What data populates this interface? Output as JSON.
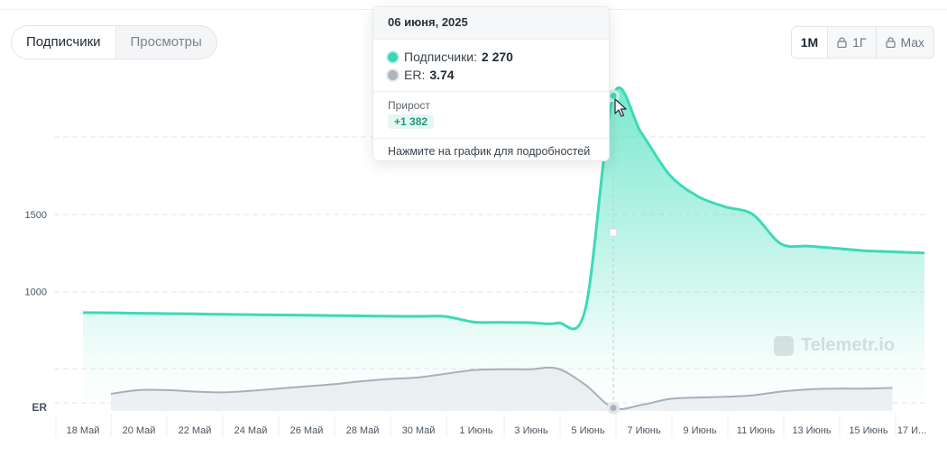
{
  "tabs": [
    {
      "label": "Подписчики",
      "active": true
    },
    {
      "label": "Просмотры",
      "active": false
    }
  ],
  "period": [
    {
      "label": "1М",
      "active": true,
      "locked": false,
      "icon": ""
    },
    {
      "label": "1Г",
      "active": false,
      "locked": true,
      "icon": "lock-icon"
    },
    {
      "label": "Max",
      "active": false,
      "locked": true,
      "icon": "lock-icon"
    }
  ],
  "tooltip": {
    "date": "06 июня, 2025",
    "subs_label": "Подписчики:",
    "subs_value": "2 270",
    "er_label": "ER:",
    "er_value": "3.74",
    "growth_label": "Прирост",
    "growth_value": "+1 382",
    "hint": "Нажмите на график для подробностей"
  },
  "watermark": {
    "text": "Telemetr.io"
  },
  "colors": {
    "subscribers_line": "#3dd9b8",
    "subscribers_fill": "#4ee0c0",
    "er_line": "#a7b0b9",
    "er_fill": "#eef0f3",
    "grid": "#e3e6ea"
  },
  "chart_data": {
    "type": "line",
    "x_tick_labels": [
      "18 Май",
      "20 Май",
      "22 Май",
      "24 Май",
      "26 Май",
      "28 Май",
      "30 Май",
      "1 Июнь",
      "3 Июнь",
      "5 Июнь",
      "7 Июнь",
      "9 Июнь",
      "11 Июнь",
      "13 Июнь",
      "15 Июнь",
      "17 И..."
    ],
    "x": [
      "18 Май",
      "19 Май",
      "20 Май",
      "21 Май",
      "22 Май",
      "23 Май",
      "24 Май",
      "25 Май",
      "26 Май",
      "27 Май",
      "28 Май",
      "29 Май",
      "30 Май",
      "31 Май",
      "1 Июнь",
      "2 Июнь",
      "3 Июнь",
      "4 Июнь",
      "5 Июнь",
      "6 Июнь",
      "7 Июнь",
      "8 Июнь",
      "9 Июнь",
      "10 Июнь",
      "11 Июнь",
      "12 Июнь",
      "13 Июнь",
      "14 Июнь",
      "15 Июнь",
      "16 Июнь",
      "17 Июнь"
    ],
    "y_ticks": [
      1000,
      1500
    ],
    "ylim": [
      500,
      2300
    ],
    "series": [
      {
        "name": "Подписчики",
        "axis": "subscribers",
        "values": [
          863,
          862,
          859,
          857,
          855,
          852,
          850,
          848,
          846,
          844,
          842,
          840,
          839,
          838,
          802,
          800,
          798,
          796,
          888,
          2270,
          2030,
          1760,
          1620,
          1550,
          1500,
          1310,
          1295,
          1280,
          1265,
          1258,
          1250
        ]
      },
      {
        "name": "ER",
        "axis": "er",
        "values": [
          null,
          3.93,
          3.98,
          3.98,
          3.96,
          3.95,
          3.97,
          4.0,
          4.03,
          4.06,
          4.1,
          4.13,
          4.15,
          4.2,
          4.25,
          4.26,
          4.26,
          4.27,
          4.05,
          3.74,
          3.78,
          3.86,
          3.88,
          3.89,
          3.91,
          3.96,
          3.99,
          4.0,
          4.0,
          4.01,
          null
        ]
      }
    ],
    "er_ylim": [
      3.7,
      4.33
    ],
    "y2_label": "ER",
    "highlight": {
      "x": "6 Июнь",
      "subscribers": 2270,
      "er": 3.74
    },
    "grid": true,
    "legend": "none"
  }
}
